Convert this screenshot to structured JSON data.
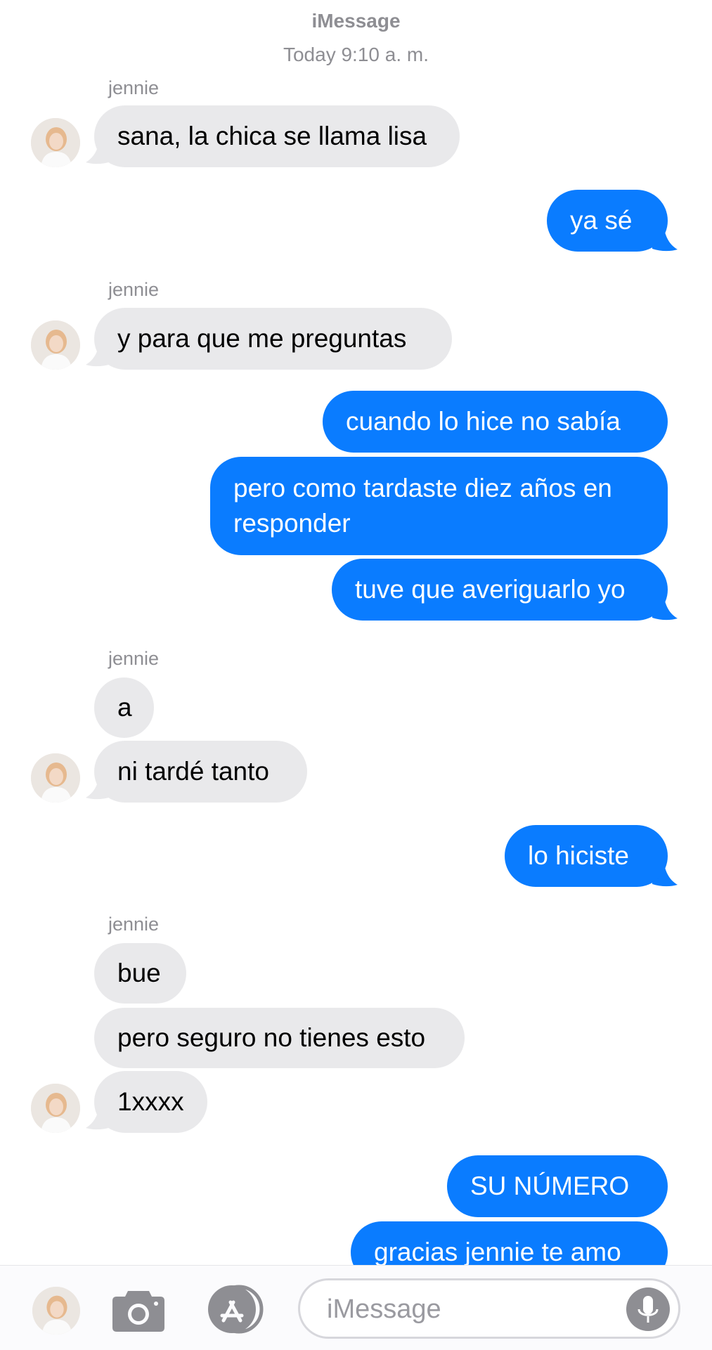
{
  "header": {
    "service": "iMessage",
    "timestamp": "Today 9:10 a. m."
  },
  "contact": {
    "name": "jennie"
  },
  "messages": [
    {
      "from": "jennie",
      "text": "sana, la chica se llama lisa"
    },
    {
      "from": "me",
      "text": "ya sé"
    },
    {
      "from": "jennie",
      "text": "y para que me preguntas"
    },
    {
      "from": "me",
      "text": "cuando lo hice no sabía"
    },
    {
      "from": "me",
      "text": "pero como tardaste diez años en responder"
    },
    {
      "from": "me",
      "text": "tuve que averiguarlo yo"
    },
    {
      "from": "jennie",
      "text": "a"
    },
    {
      "from": "jennie",
      "text": "ni tardé tanto"
    },
    {
      "from": "me",
      "text": "lo hiciste"
    },
    {
      "from": "jennie",
      "text": "bue"
    },
    {
      "from": "jennie",
      "text": "pero seguro no tienes esto"
    },
    {
      "from": "jennie",
      "text": "1xxxx"
    },
    {
      "from": "me",
      "text": "SU NÚMERO"
    },
    {
      "from": "me",
      "text": "gracias jennie te amo"
    }
  ],
  "composer": {
    "placeholder": "iMessage",
    "icons": [
      "avatar",
      "camera-icon",
      "app-store-icon",
      "microphone-icon"
    ]
  },
  "colors": {
    "outgoing": "#0a7cff",
    "incoming": "#e9e9eb",
    "meta_text": "#8e8e93"
  }
}
